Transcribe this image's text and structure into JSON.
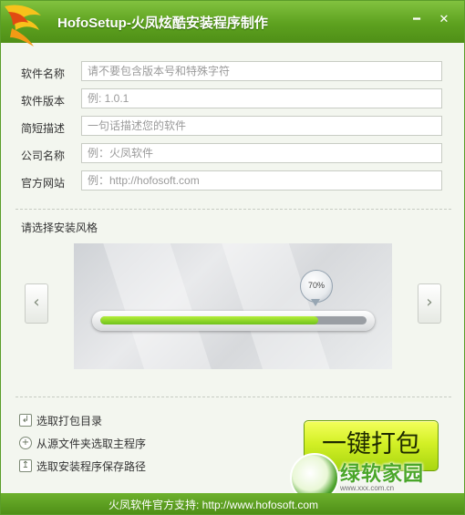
{
  "window": {
    "title": "HofoSetup-火凤炫酷安装程序制作",
    "minimize_glyph": "━",
    "close_glyph": "✕"
  },
  "form": {
    "fields": [
      {
        "label": "软件名称",
        "placeholder": "请不要包含版本号和特殊字符",
        "value": ""
      },
      {
        "label": "软件版本",
        "placeholder": "例: 1.0.1",
        "value": ""
      },
      {
        "label": "简短描述",
        "placeholder": "一句话描述您的软件",
        "value": ""
      },
      {
        "label": "公司名称",
        "placeholder": "例：火凤软件",
        "value": ""
      },
      {
        "label": "官方网站",
        "placeholder": "例：http://hofosoft.com",
        "value": ""
      }
    ]
  },
  "style_section": {
    "label": "请选择安装风格",
    "prev_glyph": "‹",
    "next_glyph": "›",
    "preview": {
      "progress_label": "70%",
      "progress_fraction": 0.82
    }
  },
  "links": [
    {
      "label": "选取打包目录",
      "icon": "folder-icon"
    },
    {
      "label": "从源文件夹选取主程序",
      "icon": "add-circle-icon"
    },
    {
      "label": "选取安装程序保存路径",
      "icon": "save-icon"
    }
  ],
  "build_button": {
    "label": "一键打包"
  },
  "watermark": {
    "text": "绿软家园",
    "url": "www.xxx.com.cn"
  },
  "footer": {
    "text": "火凤软件官方支持: http://www.hofosoft.com"
  },
  "colors": {
    "titlebar": "#5da11f",
    "accent_green": "#7fcf1f",
    "button_yellow": "#d3f026",
    "footer": "#4f8f17"
  }
}
